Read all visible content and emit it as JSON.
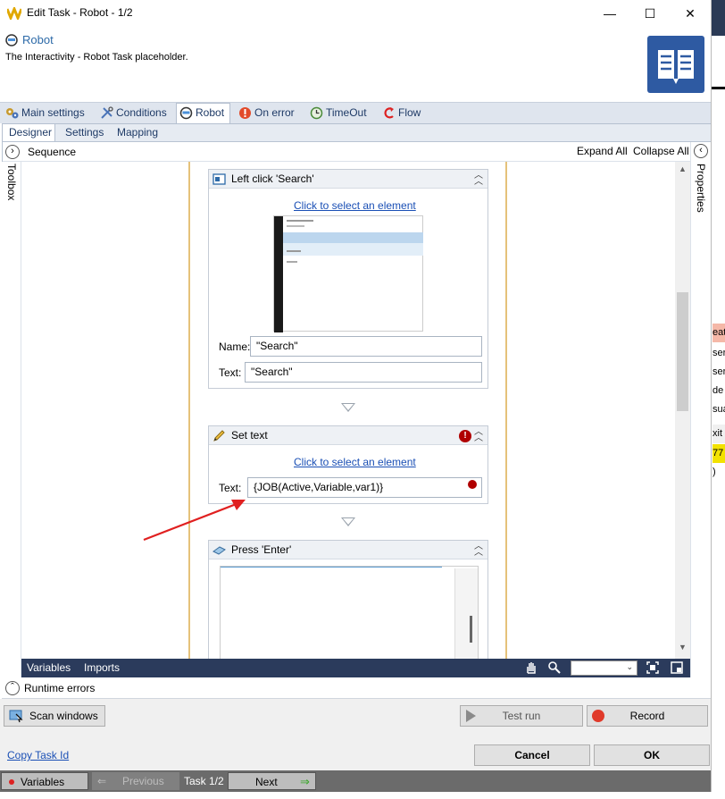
{
  "window": {
    "title": "Edit Task - Robot - 1/2",
    "minimize": "—",
    "maximize": "☐",
    "close": "✕"
  },
  "header": {
    "title": "Robot",
    "description": "The Interactivity - Robot Task placeholder."
  },
  "tabs": [
    {
      "label": "Main settings"
    },
    {
      "label": "Conditions"
    },
    {
      "label": "Robot"
    },
    {
      "label": "On error"
    },
    {
      "label": "TimeOut"
    },
    {
      "label": "Flow"
    }
  ],
  "subtabs": [
    {
      "label": "Designer"
    },
    {
      "label": "Settings"
    },
    {
      "label": "Mapping"
    }
  ],
  "designer": {
    "sequence_label": "Sequence",
    "expand_all": "Expand All",
    "collapse_all": "Collapse All",
    "toolbox_label": "Toolbox",
    "properties_label": "Properties"
  },
  "activities": {
    "left_click": {
      "title": "Left click 'Search'",
      "select_link": "Click to select an element",
      "name_label": "Name:",
      "name_value": "\"Search\"",
      "text_label": "Text:",
      "text_value": "\"Search\""
    },
    "set_text": {
      "title": "Set text",
      "select_link": "Click to select an element",
      "text_label": "Text:",
      "text_value": "{JOB(Active,Variable,var1)}",
      "error_glyph": "!"
    },
    "press_enter": {
      "title": "Press 'Enter'"
    }
  },
  "bottom_bar": {
    "variables": "Variables",
    "imports": "Imports"
  },
  "runtime_errors": "Runtime errors",
  "buttons": {
    "scan_windows": "Scan windows",
    "test_run": "Test run",
    "record": "Record",
    "copy_task_id": "Copy Task Id",
    "cancel": "Cancel",
    "ok": "OK"
  },
  "statusbar": {
    "variables": "Variables",
    "previous": "Previous",
    "task_counter": "Task 1/2",
    "next": "Next"
  },
  "background_window": {
    "cells": [
      "eat",
      "ser",
      "ser",
      "de",
      "sua",
      "xit",
      "77",
      ")"
    ]
  },
  "colors": {
    "accent_blue": "#2d6aa8",
    "navy_bar": "#2b3b5c",
    "error_red": "#b00000",
    "annotation_arrow": "#e02020",
    "rail_gold": "#e5c27a"
  }
}
